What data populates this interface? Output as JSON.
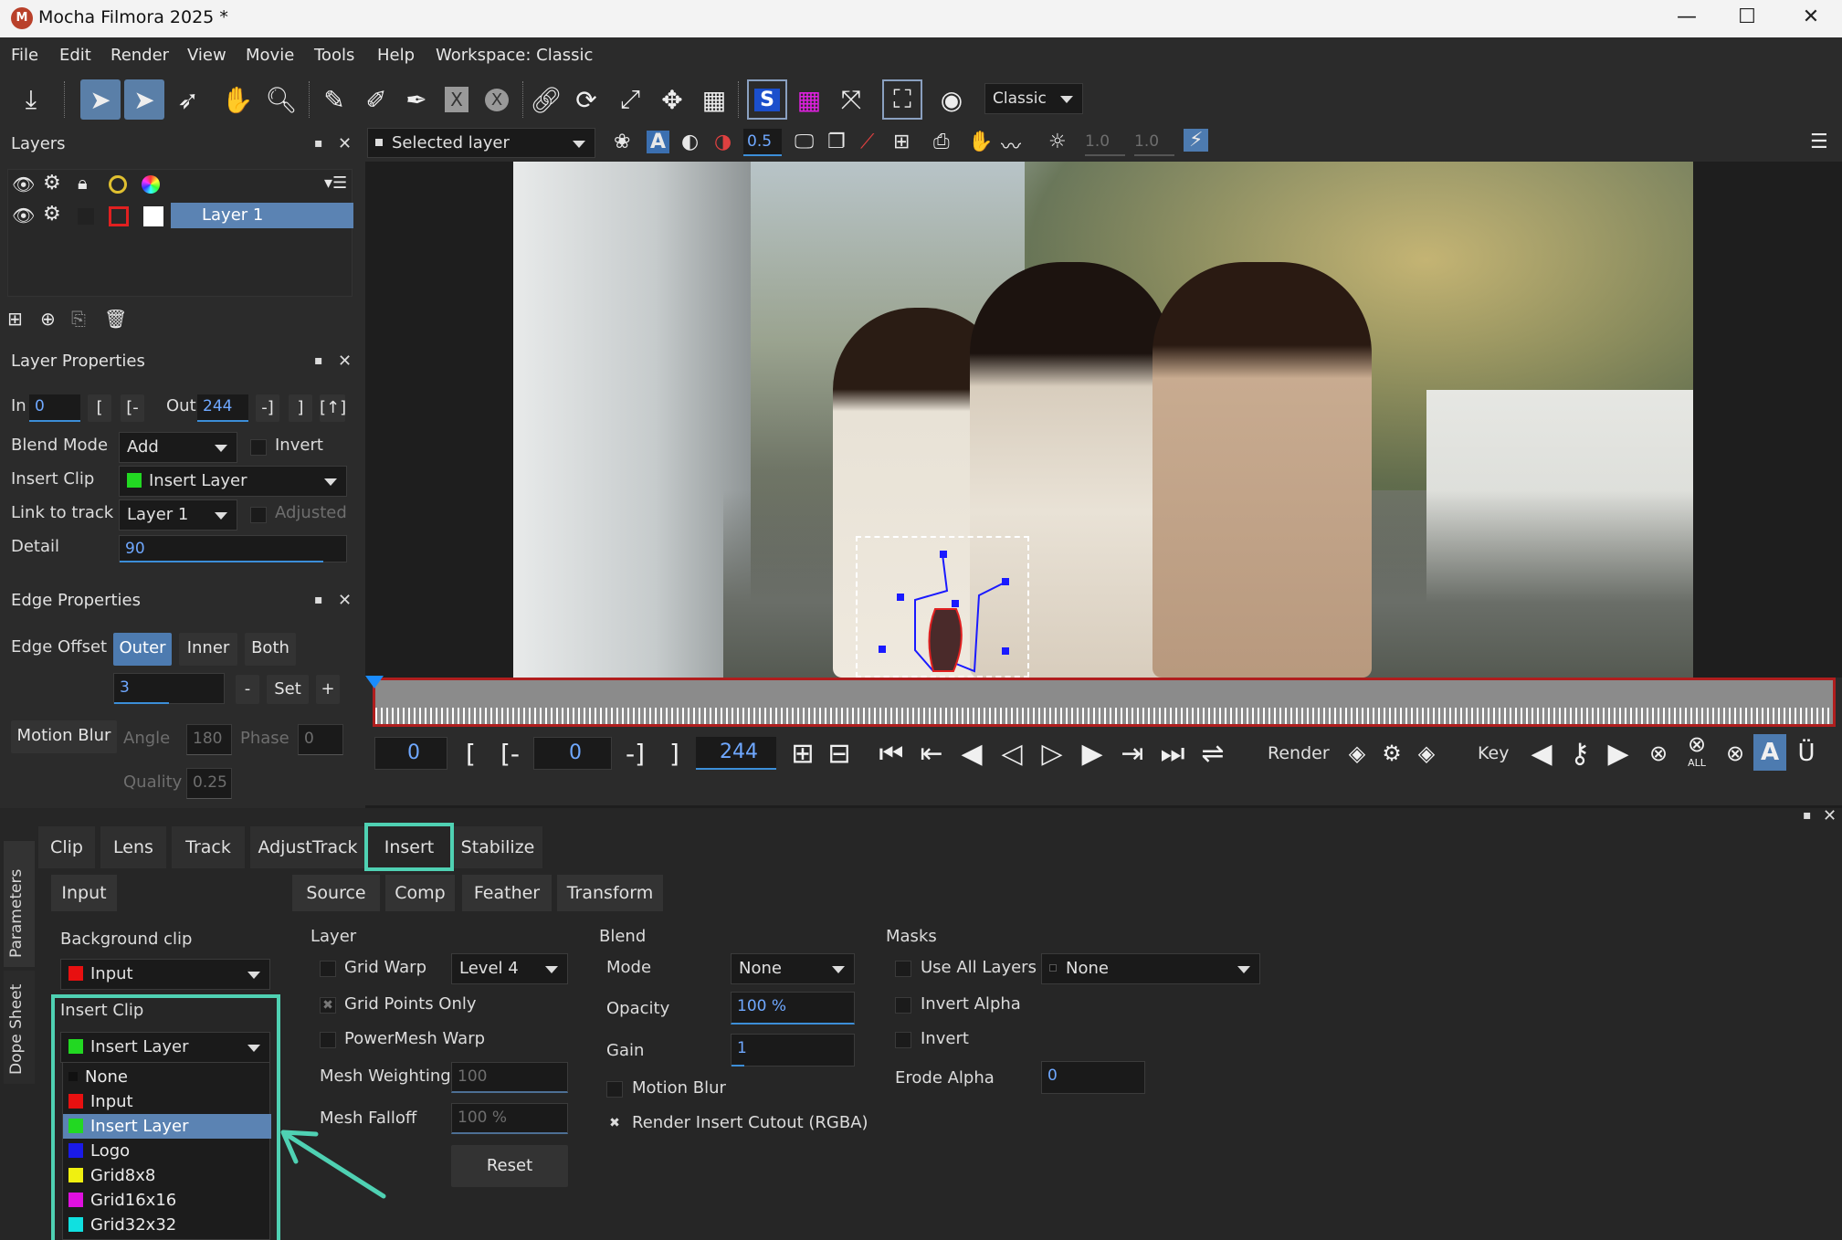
{
  "window": {
    "title": "Mocha Filmora 2025 *",
    "logo_text": "M",
    "minimize": "—",
    "maximize": "☐",
    "close": "✕"
  },
  "menu": [
    "File",
    "Edit",
    "Render",
    "View",
    "Movie",
    "Tools",
    "Help",
    "Workspace: Classic"
  ],
  "toolbar": {
    "workspace": "Classic"
  },
  "viewer_bar": {
    "layer_select": "Selected layer",
    "opacity_value": "0.5",
    "value_a": "1.0",
    "value_b": "1.0"
  },
  "layers_panel": {
    "title": "Layers",
    "layer_name": "Layer 1"
  },
  "layer_properties": {
    "title": "Layer Properties",
    "in_label": "In",
    "in_value": "0",
    "out_label": "Out",
    "out_value": "244",
    "bracket_btns": [
      "[",
      "[-",
      "-]",
      "]",
      "[↑]"
    ],
    "blend_mode_label": "Blend Mode",
    "blend_mode": "Add",
    "invert_label": "Invert",
    "insert_clip_label": "Insert Clip",
    "insert_clip": "Insert Layer",
    "link_label": "Link to track",
    "link_value": "Layer 1",
    "adjusted_label": "Adjusted",
    "detail_label": "Detail",
    "detail_value": "90",
    "detail_fraction": 0.9
  },
  "edge_properties": {
    "title": "Edge Properties",
    "edge_offset_label": "Edge Offset",
    "outer": "Outer",
    "inner": "Inner",
    "both": "Both",
    "offset_value": "3",
    "minus": "-",
    "set": "Set",
    "plus": "+",
    "motion_blur": "Motion Blur",
    "angle_label": "Angle",
    "angle_value": "180",
    "phase_label": "Phase",
    "phase_value": "0",
    "quality_label": "Quality",
    "quality_value": "0.25"
  },
  "timeline": {
    "in_frame": "0",
    "current_frame": "0",
    "out_frame": "244",
    "render_label": "Render",
    "key_label": "Key",
    "bracket_a": "[",
    "bracket_b": "[-",
    "bracket_c": "-]",
    "bracket_d": "]",
    "all_label": "ALL"
  },
  "parameters": {
    "side_tabs": [
      "Parameters",
      "Dope Sheet"
    ],
    "tabs": [
      "Clip",
      "Lens",
      "Track",
      "AdjustTrack",
      "Insert",
      "Stabilize"
    ],
    "active_tab": "Insert",
    "input_tab": "Input",
    "sub_tabs": [
      "Source",
      "Comp",
      "Feather",
      "Transform"
    ],
    "background_clip_label": "Background clip",
    "background_clip": "Input",
    "insert_clip_label": "Insert Clip",
    "insert_clip": "Insert Layer",
    "dropdown_items": [
      {
        "label": "None",
        "color": "#111111"
      },
      {
        "label": "Input",
        "color": "#e81010"
      },
      {
        "label": "Insert Layer",
        "color": "#22d822"
      },
      {
        "label": "Logo",
        "color": "#1a1ae8"
      },
      {
        "label": "Grid8x8",
        "color": "#f0f010"
      },
      {
        "label": "Grid16x16",
        "color": "#e010e0"
      },
      {
        "label": "Grid32x32",
        "color": "#10e0e0"
      }
    ],
    "layer": {
      "title": "Layer",
      "grid_warp": "Grid Warp",
      "grid_warp_level": "Level 4",
      "grid_points_only": "Grid Points Only",
      "powermesh_warp": "PowerMesh Warp",
      "mesh_weighting_label": "Mesh Weighting",
      "mesh_weighting": "100",
      "mesh_falloff_label": "Mesh Falloff",
      "mesh_falloff": "100 %",
      "reset": "Reset"
    },
    "blend": {
      "title": "Blend",
      "mode_label": "Mode",
      "mode": "None",
      "opacity_label": "Opacity",
      "opacity": "100 %",
      "gain_label": "Gain",
      "gain": "1",
      "motion_blur": "Motion Blur",
      "render_cutout": "Render Insert Cutout (RGBA)"
    },
    "masks": {
      "title": "Masks",
      "use_all_layers": "Use All Layers",
      "layers_value": "None",
      "invert_alpha": "Invert Alpha",
      "invert": "Invert",
      "erode_alpha_label": "Erode Alpha",
      "erode_alpha": "0"
    }
  },
  "colors": {
    "accent": "#5b83b3",
    "highlight": "#4fd1b3",
    "timeline_red": "#b01e1e"
  }
}
